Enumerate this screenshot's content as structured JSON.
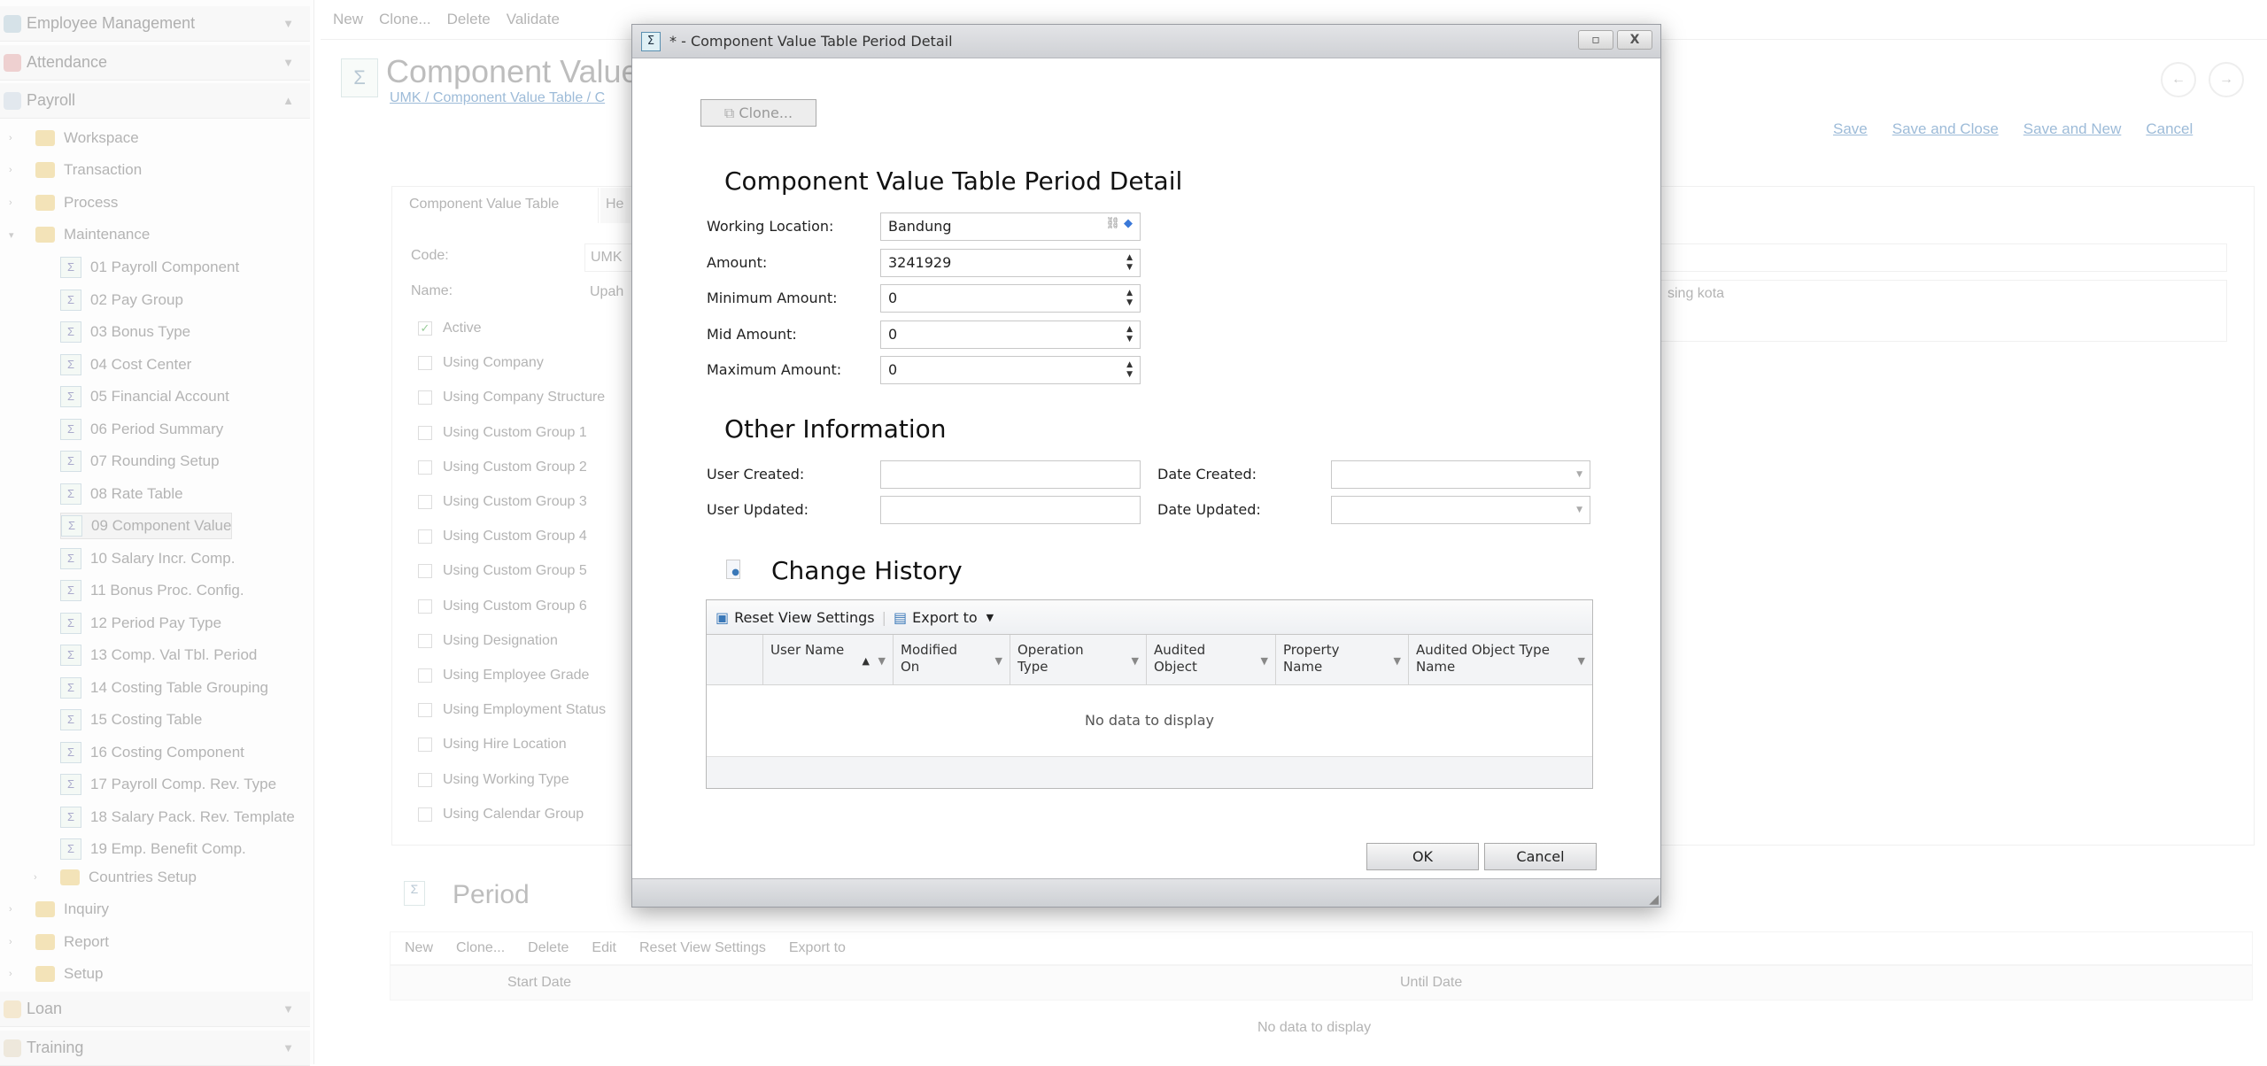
{
  "sidebar": {
    "groups": [
      {
        "label": "Employee Management",
        "expanded": false
      },
      {
        "label": "Attendance",
        "expanded": false
      },
      {
        "label": "Payroll",
        "expanded": true
      },
      {
        "label": "Loan",
        "expanded": false
      },
      {
        "label": "Training",
        "expanded": false
      }
    ],
    "folders": [
      "Workspace",
      "Transaction",
      "Process",
      "Maintenance"
    ],
    "maintenance_items": [
      "01 Payroll Component",
      "02 Pay Group",
      "03 Bonus Type",
      "04 Cost Center",
      "05 Financial Account",
      "06 Period Summary",
      "07 Rounding Setup",
      "08 Rate Table",
      "09 Component Value",
      "10 Salary Incr. Comp.",
      "11 Bonus Proc. Config.",
      "12 Period Pay Type",
      "13 Comp. Val Tbl. Period",
      "14 Costing Table Grouping",
      "15 Costing Table",
      "16 Costing Component",
      "17 Payroll Comp. Rev. Type",
      "18 Salary Pack. Rev. Template",
      "19 Emp. Benefit Comp."
    ],
    "selected_item": "09 Component Value",
    "after_items": [
      "Countries Setup",
      "Inquiry",
      "Report",
      "Setup"
    ]
  },
  "toolbar": {
    "new": "New",
    "clone": "Clone...",
    "delete": "Delete",
    "validate": "Validate"
  },
  "page": {
    "title": "Component Value",
    "breadcrumb": [
      "UMK",
      "Component Value Table",
      "C"
    ],
    "actions": {
      "save": "Save",
      "save_close": "Save and Close",
      "save_new": "Save and New",
      "cancel": "Cancel"
    },
    "tabs": [
      "Component Value Table",
      "He"
    ],
    "code_label": "Code:",
    "code_value": "UMK",
    "name_label": "Name:",
    "name_value": "Upah",
    "description_fragment": "sing kota",
    "checkboxes": [
      {
        "label": "Active",
        "checked": true
      },
      {
        "label": "Using Company",
        "checked": false
      },
      {
        "label": "Using Company Structure",
        "checked": false
      },
      {
        "label": "Using Custom Group 1",
        "checked": false
      },
      {
        "label": "Using Custom Group 2",
        "checked": false
      },
      {
        "label": "Using Custom Group 3",
        "checked": false
      },
      {
        "label": "Using Custom Group 4",
        "checked": false
      },
      {
        "label": "Using Custom Group 5",
        "checked": false
      },
      {
        "label": "Using Custom Group 6",
        "checked": false
      },
      {
        "label": "Using Designation",
        "checked": false
      },
      {
        "label": "Using Employee Grade",
        "checked": false
      },
      {
        "label": "Using Employment Status",
        "checked": false
      },
      {
        "label": "Using Hire Location",
        "checked": false
      },
      {
        "label": "Using Working Type",
        "checked": false
      },
      {
        "label": "Using Calendar Group",
        "checked": false
      }
    ],
    "period": {
      "title": "Period",
      "toolbar": [
        "New",
        "Clone...",
        "Delete",
        "Edit",
        "Reset View Settings",
        "Export to"
      ],
      "columns": [
        "Start Date",
        "Until Date"
      ],
      "empty": "No data to display"
    }
  },
  "dialog": {
    "title": "* - Component Value Table Period Detail",
    "clone": "Clone...",
    "heading": "Component Value Table Period Detail",
    "fields": [
      {
        "label": "Working Location:",
        "value": "Bandung",
        "type": "lookup"
      },
      {
        "label": "Amount:",
        "value": "3241929",
        "type": "spin"
      },
      {
        "label": "Minimum Amount:",
        "value": "0",
        "type": "spin"
      },
      {
        "label": "Mid Amount:",
        "value": "0",
        "type": "spin"
      },
      {
        "label": "Maximum Amount:",
        "value": "0",
        "type": "spin"
      }
    ],
    "other_heading": "Other Information",
    "user_created": {
      "label": "User Created:",
      "value": ""
    },
    "user_updated": {
      "label": "User Updated:",
      "value": ""
    },
    "date_created": {
      "label": "Date Created:",
      "value": ""
    },
    "date_updated": {
      "label": "Date Updated:",
      "value": ""
    },
    "history_heading": "Change History",
    "grid_toolbar": {
      "reset": "Reset View Settings",
      "export": "Export to"
    },
    "columns": [
      "User Name",
      "Modified On",
      "Operation Type",
      "Audited Object",
      "Property Name",
      "Audited Object Type Name"
    ],
    "sorted_column": "User Name",
    "empty": "No data to display",
    "ok": "OK",
    "cancel": "Cancel"
  }
}
